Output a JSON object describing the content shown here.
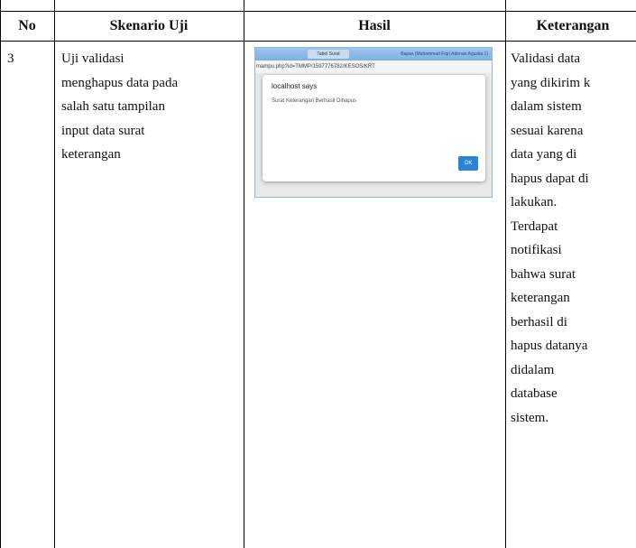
{
  "table": {
    "headers": {
      "no": "No",
      "skenario": "Skenario Uji",
      "hasil": "Hasil",
      "keterangan": "Keterangan"
    },
    "row": {
      "no": "3",
      "skenario_lines": [
        "Uji validasi",
        "menghapus data pada",
        "salah satu tampilan",
        "input data surat",
        "keterangan"
      ],
      "keterangan_lines": [
        "Validasi data",
        "yang dikirim k",
        "dalam sistem",
        "sesuai karena",
        "data yang di",
        "hapus dapat di",
        "lakukan.",
        "Terdapat",
        "notifikasi",
        "bahwa surat",
        "keterangan",
        "berhasil di",
        "hapus datanya",
        "didalam",
        "database",
        "sistem."
      ]
    }
  },
  "screenshot": {
    "tab_label": "Tabel Surat",
    "window_title": "Bapas (Muhammad Fiqri Adenan Aguska 1)",
    "url": "mampu.php?id=TMMP/1597776782/KESOS/KRT",
    "dialog": {
      "title": "localhost says",
      "message": "Surat Keterangan Berhasil Dihapus",
      "ok_label": "OK"
    }
  }
}
